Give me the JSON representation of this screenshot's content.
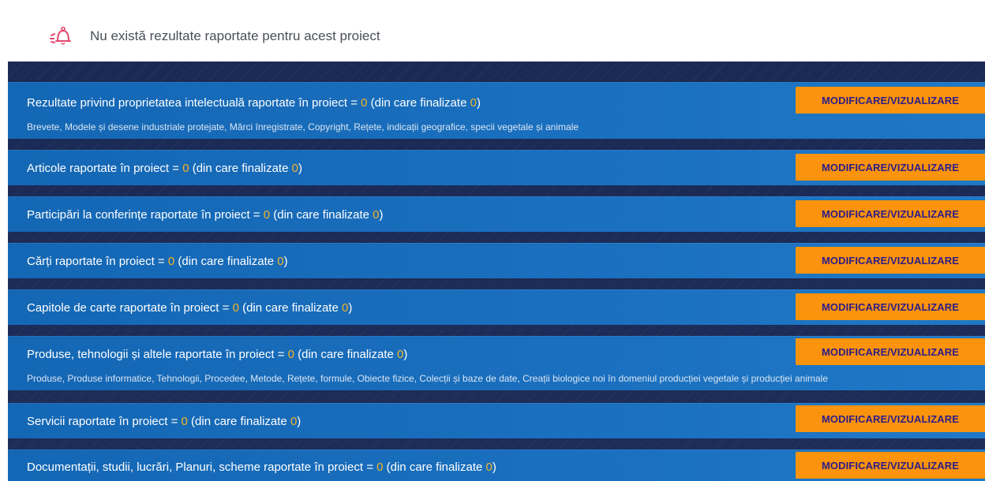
{
  "notice": {
    "icon": "bell-alert-icon",
    "text": "Nu există rezultate raportate pentru acest proiect"
  },
  "colors": {
    "accent_number": "#f5b325",
    "button_bg": "#fb930c",
    "button_text": "#2d1d88",
    "row_bg": "#1467b4",
    "panel_bg": "#1b2a55"
  },
  "rows": [
    {
      "prefix": "Rezultate privind proprietatea intelectuală raportate în proiect = ",
      "count": "0",
      "middle": " (din care finalizate ",
      "finalized": "0",
      "suffix": ")",
      "description": "Brevete, Modele și desene industriale protejate, Mărci înregistrate, Copyright, Rețete, indicații geografice, specii vegetale și animale",
      "button": "MODIFICARE/VIZUALIZARE"
    },
    {
      "prefix": "Articole raportate în proiect = ",
      "count": "0",
      "middle": " (din care finalizate ",
      "finalized": "0",
      "suffix": ")",
      "button": "MODIFICARE/VIZUALIZARE"
    },
    {
      "prefix": "Participări la conferințe raportate în proiect = ",
      "count": "0",
      "middle": " (din care finalizate ",
      "finalized": "0",
      "suffix": ")",
      "button": "MODIFICARE/VIZUALIZARE"
    },
    {
      "prefix": "Cărți raportate în proiect = ",
      "count": "0",
      "middle": " (din care finalizate ",
      "finalized": "0",
      "suffix": ")",
      "button": "MODIFICARE/VIZUALIZARE"
    },
    {
      "prefix": "Capitole de carte raportate în proiect = ",
      "count": "0",
      "middle": " (din care finalizate ",
      "finalized": "0",
      "suffix": ")",
      "button": "MODIFICARE/VIZUALIZARE"
    },
    {
      "prefix": "Produse, tehnologii și altele raportate în proiect = ",
      "count": "0",
      "middle": " (din care finalizate ",
      "finalized": "0",
      "suffix": ")",
      "description": "Produse, Produse informatice, Tehnologii, Procedee, Metode, Rețete, formule, Obiecte fizice, Colecții și baze de date, Creații biologice noi în domeniul producției vegetale și producției animale",
      "button": "MODIFICARE/VIZUALIZARE"
    },
    {
      "prefix": "Servicii raportate în proiect = ",
      "count": "0",
      "middle": " (din care finalizate ",
      "finalized": "0",
      "suffix": ")",
      "button": "MODIFICARE/VIZUALIZARE"
    },
    {
      "prefix": "Documentații, studii, lucrări, Planuri, scheme raportate în proiect = ",
      "count": "0",
      "middle": " (din care finalizate ",
      "finalized": "0",
      "suffix": ")",
      "button": "MODIFICARE/VIZUALIZARE"
    }
  ]
}
